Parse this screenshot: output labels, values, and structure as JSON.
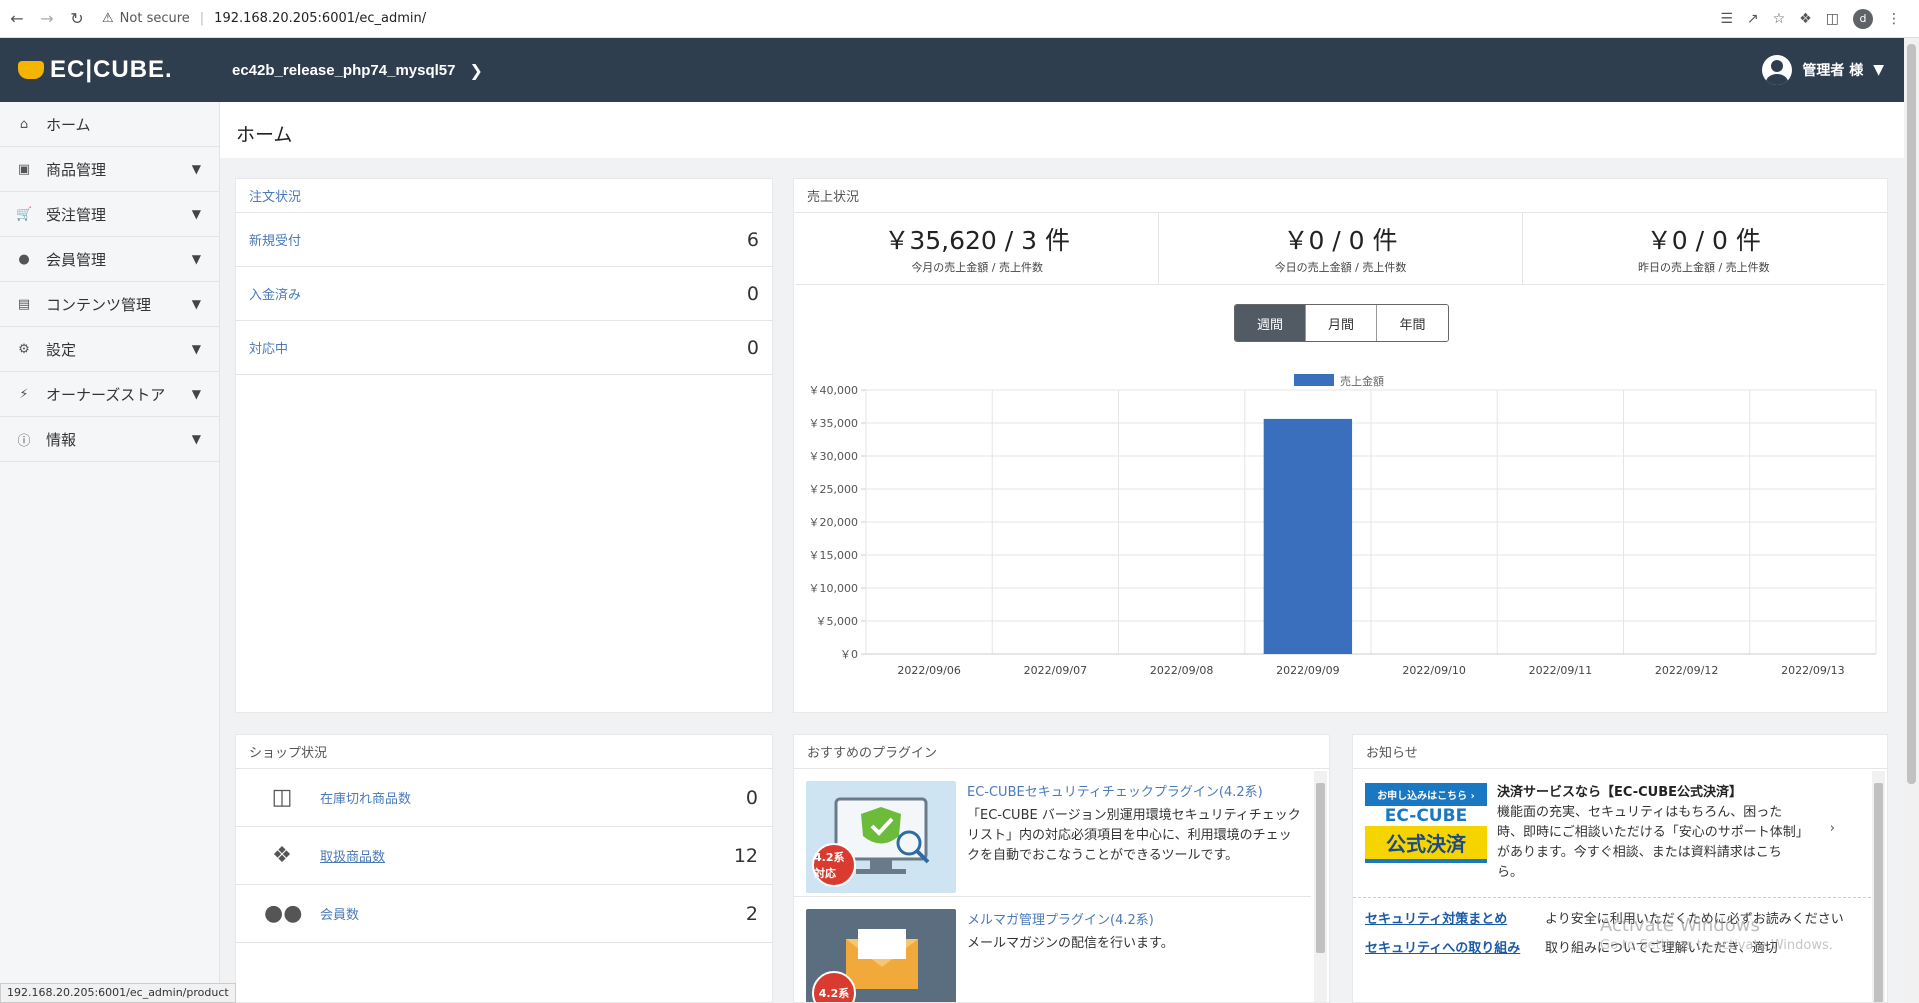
{
  "browser": {
    "security_label": "Not secure",
    "url": "192.168.20.205:6001/ec_admin/",
    "profile_initial": "d"
  },
  "header": {
    "logo_text": "EC|CUBE.",
    "shop_name": "ec42b_release_php74_mysql57",
    "admin_name": "管理者 様"
  },
  "sidebar": {
    "items": [
      {
        "label": "ホーム",
        "icon": "home-icon"
      },
      {
        "label": "商品管理",
        "icon": "box-icon"
      },
      {
        "label": "受注管理",
        "icon": "cart-icon"
      },
      {
        "label": "会員管理",
        "icon": "users-icon"
      },
      {
        "label": "コンテンツ管理",
        "icon": "file-icon"
      },
      {
        "label": "設定",
        "icon": "gear-icon"
      },
      {
        "label": "オーナーズストア",
        "icon": "plug-icon"
      },
      {
        "label": "情報",
        "icon": "info-icon"
      }
    ]
  },
  "main": {
    "title": "ホーム"
  },
  "orders": {
    "title": "注文状況",
    "rows": [
      {
        "label": "新規受付",
        "value": "6"
      },
      {
        "label": "入金済み",
        "value": "0"
      },
      {
        "label": "対応中",
        "value": "0"
      }
    ]
  },
  "sales": {
    "title": "売上状況",
    "summary": [
      {
        "amount": "￥35,620 / 3 件",
        "caption": "今月の売上金額 / 売上件数"
      },
      {
        "amount": "￥0 / 0 件",
        "caption": "今日の売上金額 / 売上件数"
      },
      {
        "amount": "￥0 / 0 件",
        "caption": "昨日の売上金額 / 売上件数"
      }
    ],
    "periods": [
      "週間",
      "月間",
      "年間"
    ],
    "active_period": "週間"
  },
  "chart_data": {
    "type": "bar",
    "categories": [
      "2022/09/06",
      "2022/09/07",
      "2022/09/08",
      "2022/09/09",
      "2022/09/10",
      "2022/09/11",
      "2022/09/12",
      "2022/09/13"
    ],
    "series": [
      {
        "name": "売上金額",
        "values": [
          0,
          0,
          0,
          35620,
          0,
          0,
          0,
          0
        ],
        "color": "#3a6fbe"
      }
    ],
    "yticks": [
      "￥0",
      "￥5,000",
      "￥10,000",
      "￥15,000",
      "￥20,000",
      "￥25,000",
      "￥30,000",
      "￥35,000",
      "￥40,000"
    ],
    "ylim": [
      0,
      40000
    ],
    "legend_position": "top",
    "grid": true
  },
  "shop": {
    "title": "ショップ状況",
    "rows": [
      {
        "label": "在庫切れ商品数",
        "value": "0",
        "icon": "inbox-icon"
      },
      {
        "label": "取扱商品数",
        "value": "12",
        "icon": "cubes-icon"
      },
      {
        "label": "会員数",
        "value": "2",
        "icon": "users-icon"
      }
    ]
  },
  "plugins": {
    "title": "おすすめのプラグイン",
    "items": [
      {
        "title": "EC-CUBEセキュリティチェックプラグイン(4.2系)",
        "desc": "「EC-CUBE バージョン別運用環境セキュリティチェックリスト」内の対応必須項目を中心に、利用環境のチェックを自動でおこなうことができるツールです。",
        "badge": "4.2系 対応"
      },
      {
        "title": "メルマガ管理プラグイン(4.2系)",
        "desc": "メールマガジンの配信を行います。",
        "badge": "4.2系"
      }
    ]
  },
  "news": {
    "title": "お知らせ",
    "banner": {
      "top": "お申し込みはこちら ›",
      "mid": "EC-CUBE",
      "bot": "公式決済"
    },
    "item_title": "決済サービスなら【EC-CUBE公式決済】",
    "item_body": "機能面の充実、セキュリティはもちろん、困った時、即時にご相談いただける「安心のサポート体制」があります。今すぐ相談、または資料請求はこちら。",
    "links": [
      {
        "label": "セキュリティ対策まとめ",
        "desc": "より安全に利用いただくために必ずお読みください"
      },
      {
        "label": "セキュリティへの取り組み",
        "desc": "取り組みについてご理解いただき、適切"
      }
    ]
  },
  "status_bar": {
    "url": "192.168.20.205:6001/ec_admin/product"
  },
  "watermark": {
    "line1": "Activate Windows",
    "line2": "Go to Settings to activate Windows."
  }
}
